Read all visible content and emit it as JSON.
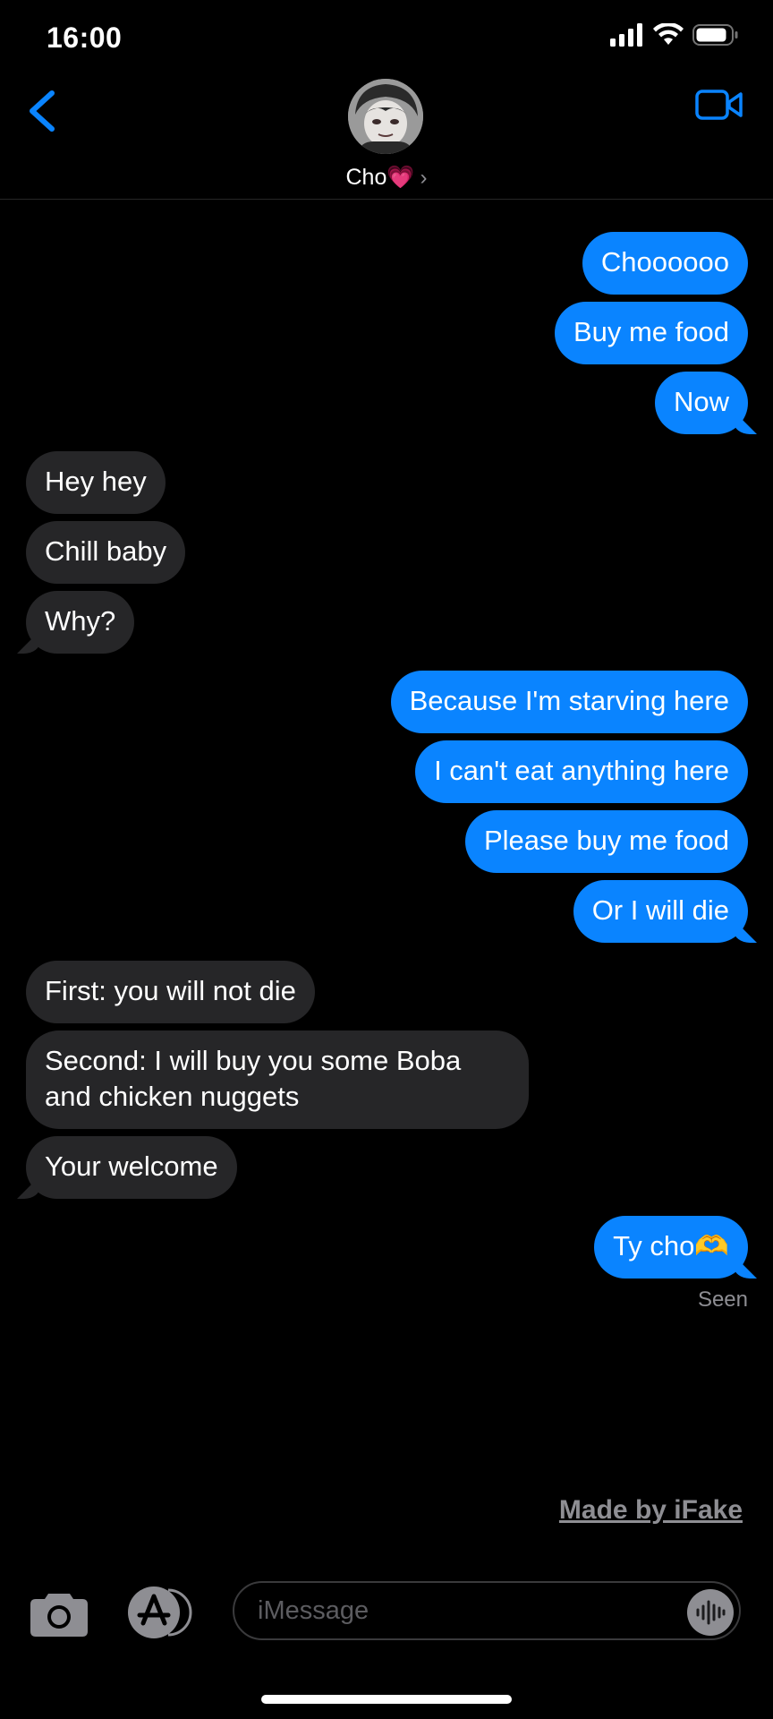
{
  "status": {
    "time": "16:00"
  },
  "header": {
    "contact_name": "Cho💗",
    "chevron": "›",
    "back_icon": "chevron-left-icon",
    "video_icon": "video-camera-icon"
  },
  "messages": [
    {
      "side": "sent",
      "text": "Choooooo"
    },
    {
      "side": "sent",
      "text": "Buy me food"
    },
    {
      "side": "sent",
      "text": "Now"
    },
    {
      "side": "recv",
      "text": "Hey hey"
    },
    {
      "side": "recv",
      "text": "Chill baby"
    },
    {
      "side": "recv",
      "text": "Why?"
    },
    {
      "side": "sent",
      "text": "Because I'm starving here"
    },
    {
      "side": "sent",
      "text": "I can't eat anything here"
    },
    {
      "side": "sent",
      "text": "Please buy me food"
    },
    {
      "side": "sent",
      "text": "Or I will die"
    },
    {
      "side": "recv",
      "text": "First: you will not die"
    },
    {
      "side": "recv",
      "text": "Second: I will buy you some Boba and chicken nuggets"
    },
    {
      "side": "recv",
      "text": "Your welcome"
    },
    {
      "side": "sent",
      "text": "Ty cho🫶"
    }
  ],
  "read_receipt": "Seen",
  "watermark": "Made by iFake",
  "composer": {
    "placeholder": "iMessage"
  },
  "colors": {
    "sent_bubble": "#0a84ff",
    "recv_bubble": "#262628",
    "accent": "#0a84ff"
  }
}
